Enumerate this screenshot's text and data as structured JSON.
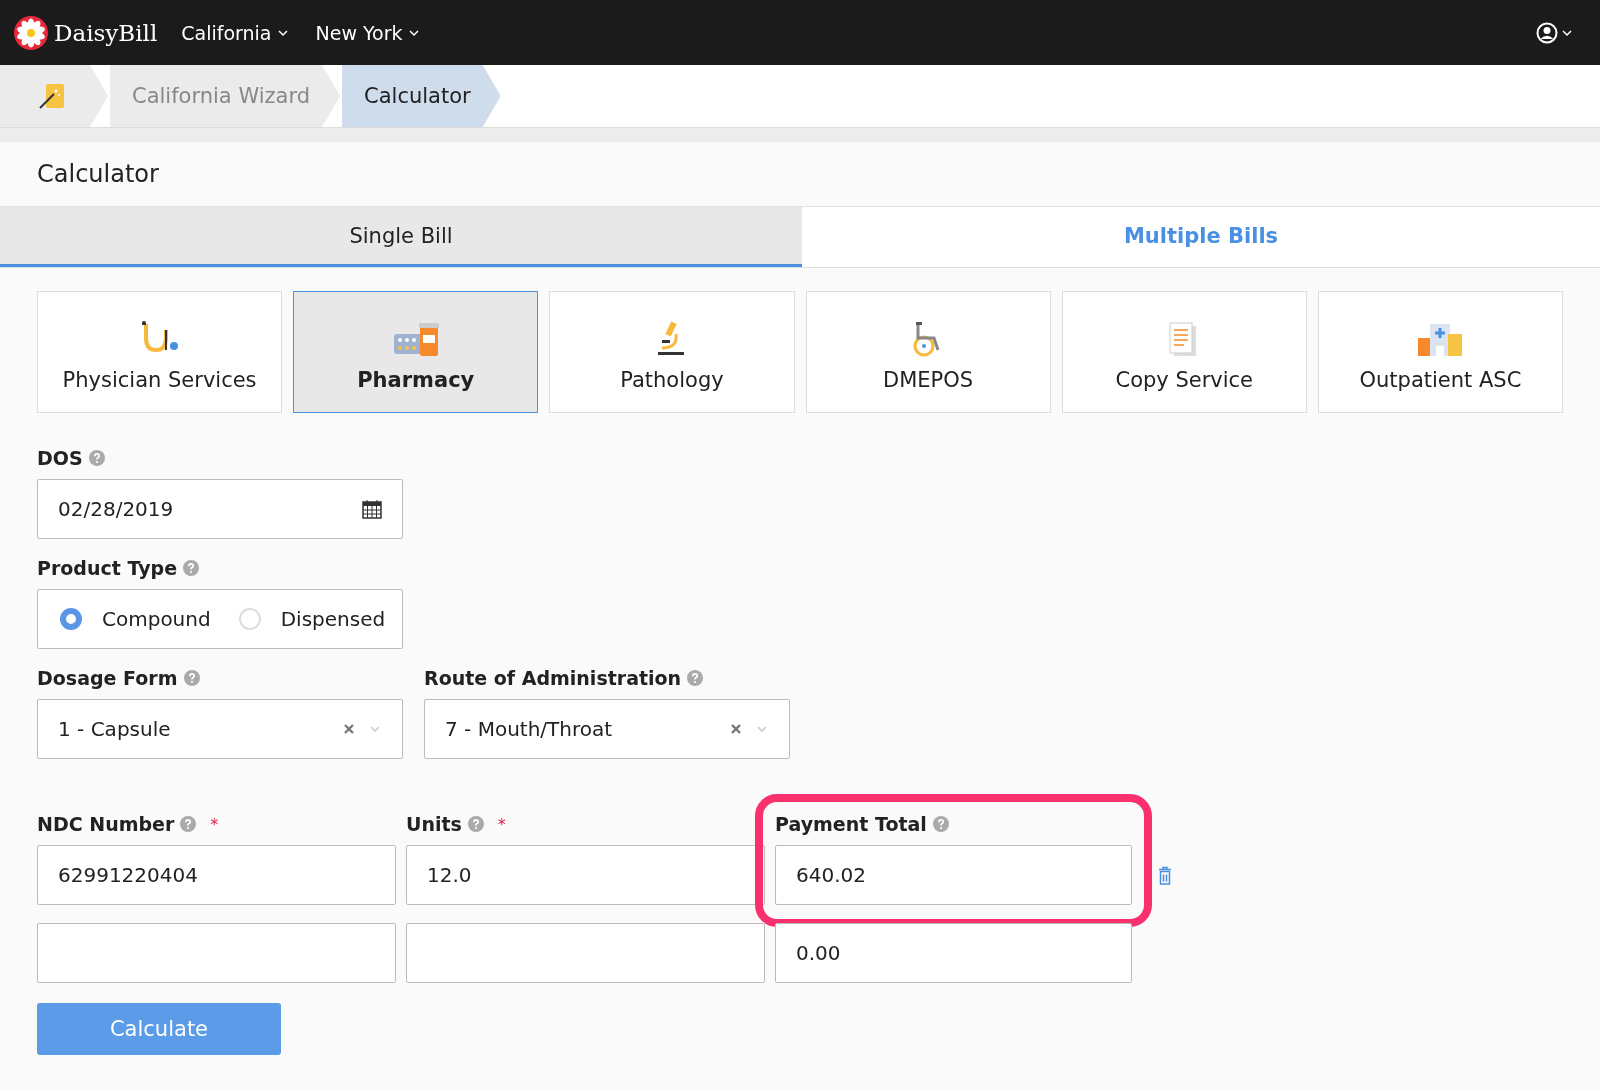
{
  "top_bar": {
    "brand": "DaisyBill",
    "menus": [
      {
        "label": "California"
      },
      {
        "label": "New York"
      }
    ]
  },
  "breadcrumb": [
    {
      "label": "California Wizard",
      "selected": false
    },
    {
      "label": "Calculator",
      "selected": true
    }
  ],
  "page_title": "Calculator",
  "tabs": [
    {
      "label": "Single Bill",
      "selected": true
    },
    {
      "label": "Multiple Bills",
      "selected": false
    }
  ],
  "services": [
    {
      "kind": "stethoscope",
      "label": "Physician Services",
      "selected": false
    },
    {
      "kind": "pills",
      "label": "Pharmacy",
      "selected": true
    },
    {
      "kind": "microscope",
      "label": "Pathology",
      "selected": false
    },
    {
      "kind": "wheelchair",
      "label": "DMEPOS",
      "selected": false
    },
    {
      "kind": "document",
      "label": "Copy Service",
      "selected": false
    },
    {
      "kind": "hospital",
      "label": "Outpatient ASC",
      "selected": false
    }
  ],
  "dos": {
    "label": "DOS",
    "value": "02/28/2019"
  },
  "product_type": {
    "label": "Product Type",
    "options": [
      {
        "label": "Compound",
        "selected": true
      },
      {
        "label": "Dispensed",
        "selected": false
      }
    ]
  },
  "dosage_form": {
    "label": "Dosage Form",
    "value": "1 - Capsule"
  },
  "route": {
    "label": "Route of Administration",
    "value": "7 - Mouth/Throat"
  },
  "line_items": {
    "columns": [
      {
        "label": "NDC Number",
        "required_mark": "*"
      },
      {
        "label": "Units",
        "required_mark": "*"
      },
      {
        "label": "Payment Total"
      }
    ],
    "rows": [
      {
        "ndc_number": "62991220404",
        "units": "12.0",
        "payment_total": "640.02",
        "deletable": true,
        "highlighted": true
      },
      {
        "payment_total": "0.00",
        "deletable": false,
        "highlighted": false
      }
    ]
  },
  "calculate_button": "Calculate"
}
